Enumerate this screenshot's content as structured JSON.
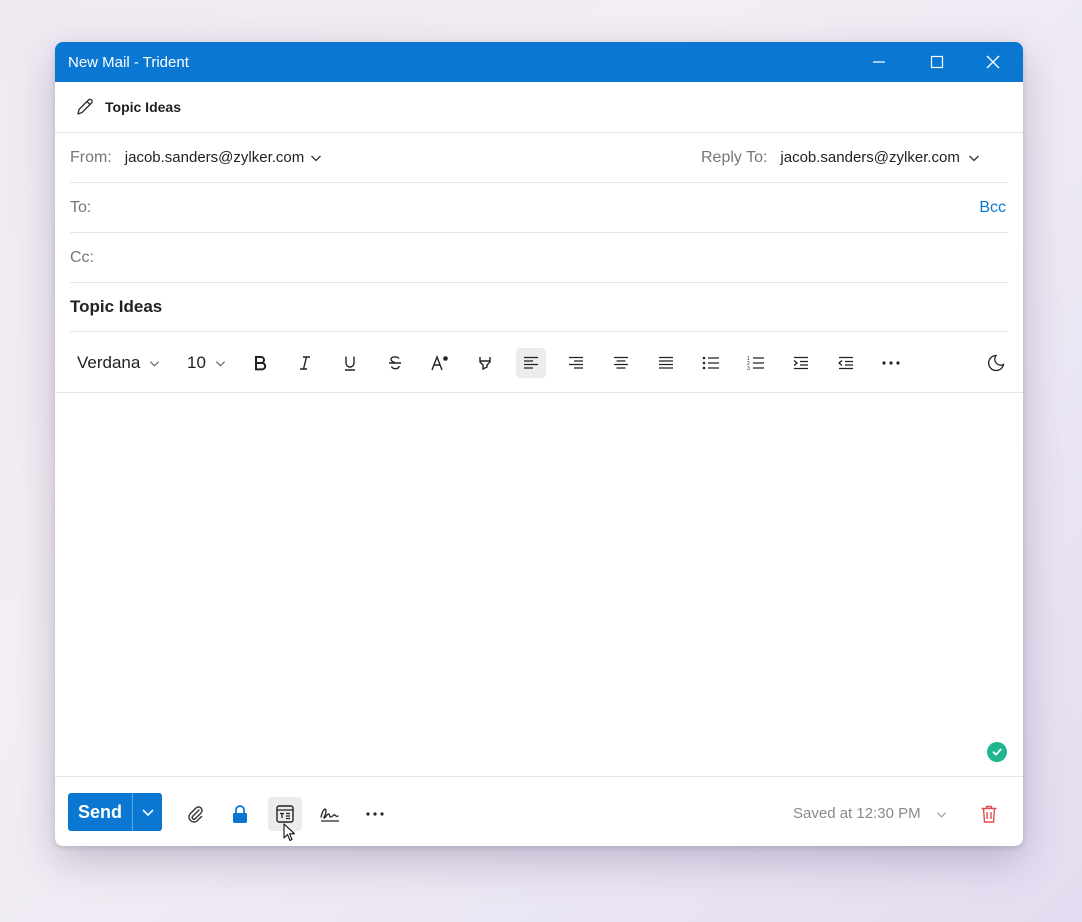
{
  "window": {
    "title": "New Mail - Trident",
    "controls": [
      "minimize-icon",
      "maximize-icon",
      "close-icon"
    ]
  },
  "subject_bar": {
    "icon": "pencil-icon",
    "title": "Topic Ideas"
  },
  "fields": {
    "from_label": "From:",
    "from_value": "jacob.sanders@zylker.com",
    "reply_to_label": "Reply To:",
    "reply_to_value": "jacob.sanders@zylker.com",
    "to_label": "To:",
    "bcc_label": "Bcc",
    "cc_label": "Cc:",
    "subject_value": "Topic Ideas"
  },
  "format_toolbar": {
    "font": "Verdana",
    "size": "10",
    "tools": [
      "bold-icon",
      "italic-icon",
      "underline-icon",
      "strikethrough-icon",
      "text-color-icon",
      "highlight-icon",
      "align-left-icon",
      "align-right-icon",
      "align-center-icon",
      "justify-icon",
      "bullet-list-icon",
      "numbered-list-icon",
      "indent-icon",
      "outdent-icon",
      "more-icon",
      "dark-mode-icon"
    ],
    "active_tool": "align-left-icon"
  },
  "bottom_bar": {
    "send_label": "Send",
    "tools": [
      "attach-icon",
      "lock-icon",
      "template-icon",
      "signature-icon",
      "more-icon"
    ],
    "active_tool": "template-icon",
    "saved_text": "Saved at 12:30 PM"
  },
  "colors": {
    "accent": "#0a78d2",
    "success": "#1fb58f",
    "delete": "#e05050"
  }
}
